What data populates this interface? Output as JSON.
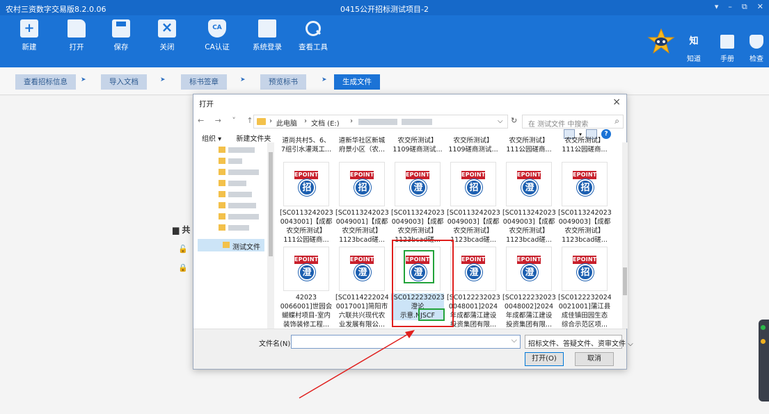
{
  "window": {
    "app_name": "农村三资数字交易版8.2.0.06",
    "doc_title": "0415公开招标测试项目-2",
    "controls": [
      "▾",
      "–",
      "⧉",
      "✕"
    ]
  },
  "toolbar": {
    "items": [
      {
        "label": "新建",
        "icon": "new-file-icon"
      },
      {
        "label": "打开",
        "icon": "folder-open-icon"
      },
      {
        "label": "保存",
        "icon": "save-icon"
      },
      {
        "label": "关闭",
        "icon": "close-file-icon"
      },
      {
        "label": "CA认证",
        "icon": "ca-shield-icon"
      },
      {
        "label": "系统登录",
        "icon": "monitor-icon"
      },
      {
        "label": "查看工具",
        "icon": "magnifier-icon"
      }
    ],
    "right_items": [
      {
        "label": "知道",
        "glyph": "知"
      },
      {
        "label": "手册",
        "glyph": ""
      },
      {
        "label": "检查",
        "glyph": ""
      }
    ]
  },
  "steps": [
    {
      "label": "查看招标信息",
      "active": false
    },
    {
      "label": "导入文档",
      "active": false
    },
    {
      "label": "标书签章",
      "active": false
    },
    {
      "label": "预览标书",
      "active": false
    },
    {
      "label": "生成文件",
      "active": true
    }
  ],
  "step_arrow": "➤",
  "background_panel": {
    "heading_fragment": "共",
    "lock_glyphs": [
      "🔓",
      "🔒"
    ]
  },
  "dialog": {
    "title": "打开",
    "close": "×",
    "nav_buttons": "← → ˅ ↑",
    "breadcrumb": [
      "此电脑",
      "文档 (E:)"
    ],
    "crumb_sep": "›",
    "dropdown": "⌵",
    "refresh": "↻",
    "search_placeholder": "在 测试文件 中搜索",
    "search_icon": "⌕",
    "organize": "组织 ▾",
    "new_folder": "新建文件夹",
    "help": "?",
    "nav_selected": "测试文件",
    "top_row_partial": [
      [
        "道尚共村5、6、",
        "7组引水灌溉工..."
      ],
      [
        "道新华社区新城",
        "府景小区（农..."
      ],
      [
        "农交所测试】",
        "1109磋商测试..."
      ],
      [
        "农交所测试】",
        "1109磋商测试..."
      ],
      [
        "农交所测试】",
        "111公园磋商..."
      ],
      [
        "农交所测试】",
        "111公园磋商..."
      ]
    ],
    "row1": [
      {
        "glyph": "招",
        "lines": [
          "[SC0113242023",
          "0043001]【成都",
          "农交所测试】",
          "111公园磋商..."
        ]
      },
      {
        "glyph": "招",
        "lines": [
          "[SC0113242023",
          "0049001]【成都",
          "农交所测试】",
          "1123bcad磋..."
        ]
      },
      {
        "glyph": "澄",
        "lines": [
          "[SC0113242023",
          "0049003]【成都",
          "农交所测试】",
          "1123bcad磋..."
        ]
      },
      {
        "glyph": "招",
        "lines": [
          "[SC0113242023",
          "0049003]【成都",
          "农交所测试】",
          "1123bcad磋..."
        ]
      },
      {
        "glyph": "澄",
        "lines": [
          "[SC0113242023",
          "0049003]【成都",
          "农交所测试】",
          "1123bcad磋..."
        ]
      },
      {
        "glyph": "招",
        "lines": [
          "[SC0113242023",
          "0049003]【成都",
          "农交所测试】",
          "1123bcad磋..."
        ]
      }
    ],
    "row2": [
      {
        "glyph": "澄",
        "lines": [
          "42023",
          "0066001]世园会",
          "蝴蝶村项目-室内",
          "装饰装修工程..."
        ]
      },
      {
        "glyph": "澄",
        "lines": [
          "[SC0114222024",
          "0017001]简阳市",
          "六联共兴现代农",
          "业发展有限公..."
        ]
      },
      {
        "glyph": "澄",
        "lines": [
          "[SC0122232023",
          "澄论",
          "示意.NJSCF"
        ],
        "selected": true
      },
      {
        "glyph": "澄",
        "lines": [
          "[SC0122232023",
          "0048001]2024",
          "年成都蒲江建设",
          "投资集团有限..."
        ]
      },
      {
        "glyph": "澄",
        "lines": [
          "[SC0122232023",
          "0048002]2024",
          "年成都蒲江建设",
          "投资集团有限..."
        ]
      },
      {
        "glyph": "招",
        "lines": [
          "[SC0122232024",
          "0021001]蒲江县",
          "成佳镇田园生态",
          "综合示范区项..."
        ]
      }
    ],
    "epoint_label": "EPOINT",
    "filename_label": "文件名(N):",
    "filename_value": "",
    "filter_value": "招标文件、答疑文件、资审文件 ⌵",
    "open_button": "打开(O)",
    "cancel_button": "取消"
  },
  "colors": {
    "titlebar": "#1669c9",
    "toolbar": "#1b73d6",
    "highlight_red": "#e0201e",
    "highlight_green": "#22a33a"
  }
}
